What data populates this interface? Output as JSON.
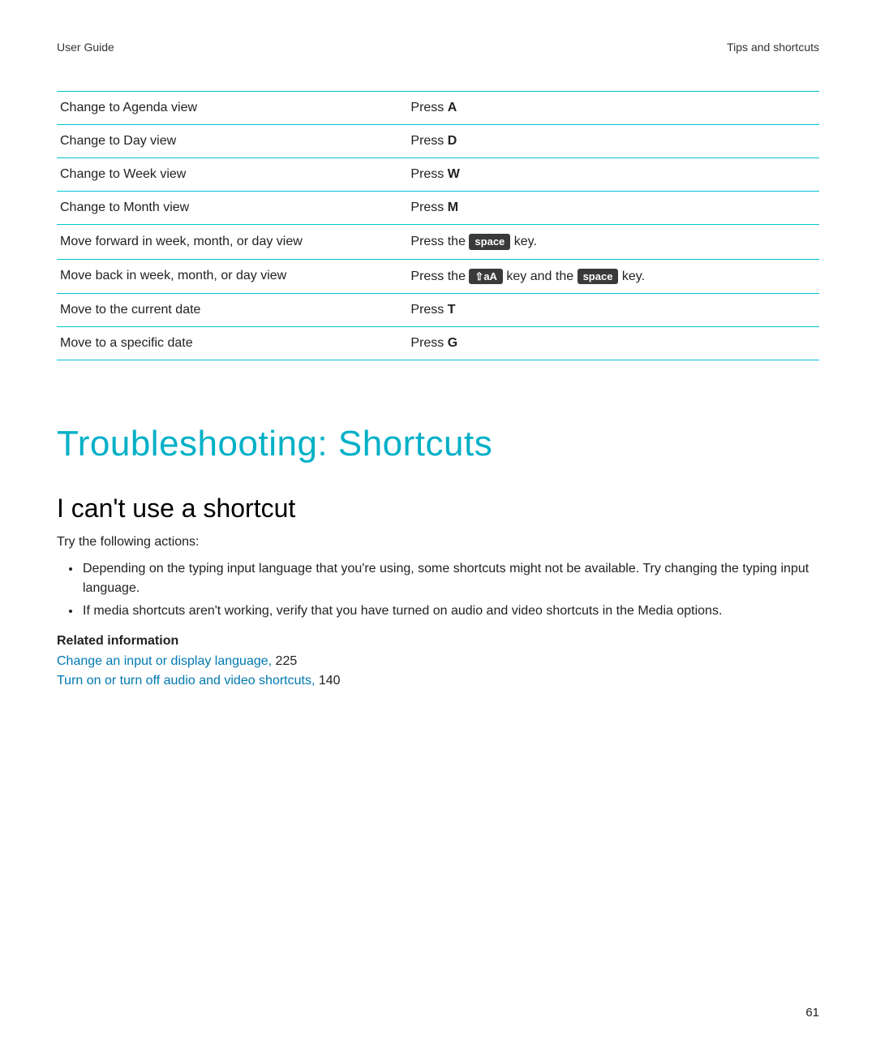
{
  "header": {
    "left": "User Guide",
    "right": "Tips and shortcuts"
  },
  "table": {
    "rows": [
      {
        "action": "Change to Agenda view",
        "prefix": "Press ",
        "key": "A",
        "type": "bold"
      },
      {
        "action": "Change to Day view",
        "prefix": "Press ",
        "key": "D",
        "type": "bold"
      },
      {
        "action": "Change to Week view",
        "prefix": "Press ",
        "key": "W",
        "type": "bold"
      },
      {
        "action": "Change to Month view",
        "prefix": "Press ",
        "key": "M",
        "type": "bold"
      },
      {
        "action": "Move forward in week, month, or day view",
        "prefix": "Press the ",
        "key": "space",
        "suffix": " key.",
        "type": "cap"
      },
      {
        "action": "Move back in week, month, or day view",
        "prefix": "Press the ",
        "key": "⇧aA",
        "mid": " key and the ",
        "key2": "space",
        "suffix": " key.",
        "type": "cap2"
      },
      {
        "action": "Move to the current date",
        "prefix": "Press ",
        "key": "T",
        "type": "bold"
      },
      {
        "action": "Move to a specific date",
        "prefix": "Press ",
        "key": "G",
        "type": "bold"
      }
    ]
  },
  "heading": "Troubleshooting: Shortcuts",
  "subheading": "I can't use a shortcut",
  "intro": "Try the following actions:",
  "bullets": [
    "Depending on the typing input language that you're using, some shortcuts might not be available. Try changing the typing input language.",
    "If media shortcuts aren't working, verify that you have turned on audio and video shortcuts in the Media options."
  ],
  "related": {
    "heading": "Related information",
    "links": [
      {
        "text": "Change an input or display language,",
        "page": "225"
      },
      {
        "text": "Turn on or turn off audio and video shortcuts,",
        "page": "140"
      }
    ]
  },
  "page_number": "61"
}
